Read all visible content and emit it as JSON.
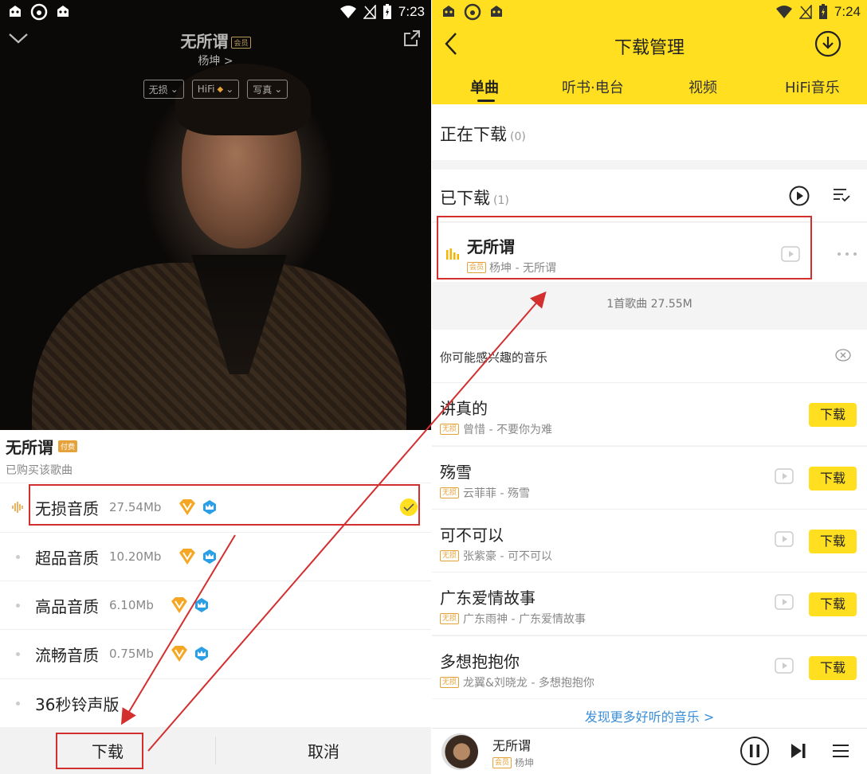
{
  "left": {
    "status": {
      "time": "7:23"
    },
    "header": {
      "title": "无所谓",
      "vip_tag": "会员",
      "artist": "杨坤 >",
      "chips": [
        {
          "label": "无损"
        },
        {
          "label": "HiFi"
        },
        {
          "label": "写真"
        }
      ]
    },
    "sheet": {
      "title": "无所谓",
      "paid_tag": "付费",
      "purchased": "已购买该歌曲",
      "qualities": [
        {
          "name": "无损音质",
          "size": "27.54Mb",
          "selected": true
        },
        {
          "name": "超品音质",
          "size": "10.20Mb",
          "selected": false
        },
        {
          "name": "高品音质",
          "size": "6.10Mb",
          "selected": false
        },
        {
          "name": "流畅音质",
          "size": "0.75Mb",
          "selected": false
        },
        {
          "name": "36秒铃声版",
          "size": "",
          "selected": false
        }
      ],
      "download_label": "下载",
      "cancel_label": "取消"
    }
  },
  "right": {
    "status": {
      "time": "7:24"
    },
    "header": {
      "title": "下载管理",
      "tabs": [
        {
          "label": "单曲",
          "active": true
        },
        {
          "label": "听书·电台",
          "active": false
        },
        {
          "label": "视频",
          "active": false
        },
        {
          "label": "HiFi音乐",
          "active": false
        }
      ]
    },
    "downloading": {
      "label": "正在下载",
      "count": "(0)"
    },
    "downloaded": {
      "label": "已下载",
      "count": "(1)"
    },
    "downloaded_song": {
      "name": "无所谓",
      "tag": "会员",
      "meta": "杨坤 - 无所谓"
    },
    "summary": "1首歌曲 27.55M",
    "recommend": {
      "title": "你可能感兴趣的音乐",
      "items": [
        {
          "name": "讲真的",
          "tag": "无损",
          "meta": "曾惜 - 不要你为难",
          "has_mv": false
        },
        {
          "name": "殇雪",
          "tag": "无损",
          "meta": "云菲菲 - 殇雪",
          "has_mv": true
        },
        {
          "name": "可不可以",
          "tag": "无损",
          "meta": "张紫豪 - 可不可以",
          "has_mv": true
        },
        {
          "name": "广东爱情故事",
          "tag": "无损",
          "meta": "广东雨神 - 广东爱情故事",
          "has_mv": true
        },
        {
          "name": "多想抱抱你",
          "tag": "无损",
          "meta": "龙翼&刘晓龙 - 多想抱抱你",
          "has_mv": true
        }
      ],
      "download_label": "下载",
      "discover": "发现更多好听的音乐 >"
    },
    "player": {
      "title": "无所谓",
      "tag": "会员",
      "artist": "杨坤"
    }
  },
  "colors": {
    "accent_yellow": "#ffdf1f",
    "highlight_red": "#d32f2f",
    "link_blue": "#3a8ed8",
    "gold": "#e6a23a"
  }
}
